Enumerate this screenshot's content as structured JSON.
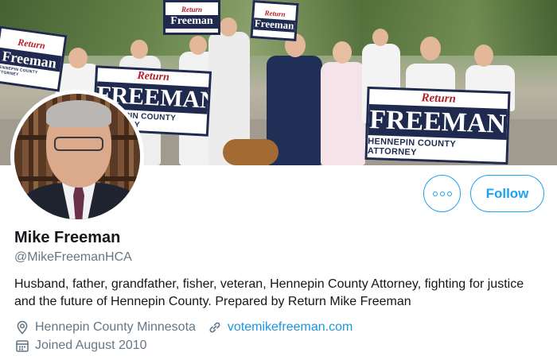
{
  "banner": {
    "signs": [
      {
        "return_text": "Return",
        "name_text": "Freeman",
        "sub_text": "HENNEPIN COUNTY ATTORNEY"
      },
      {
        "return_text": "Return",
        "name_text": "FREEMAN",
        "sub_text": "HENNEPIN COUNTY ATTORNEY"
      },
      {
        "return_text": "Return",
        "name_text": "FREEMAN",
        "sub_text": "HENNEPIN COUNTY ATTORNEY"
      },
      {
        "return_text": "Return",
        "name_text": "Freeman",
        "sub_text": ""
      },
      {
        "return_text": "Return",
        "name_text": "Freeman",
        "sub_text": ""
      }
    ]
  },
  "profile": {
    "display_name": "Mike Freeman",
    "handle": "@MikeFreemanHCA",
    "bio": "Husband, father, grandfather, fisher, veteran, Hennepin County Attorney, fighting for justice and the future of Hennepin County. Prepared by Return Mike Freeman",
    "location": "Hennepin County Minnesota",
    "website": "votemikefreeman.com",
    "joined": "Joined August 2010"
  },
  "actions": {
    "follow_label": "Follow",
    "more_icon": "more-options-icon"
  },
  "icons": {
    "location": "location-pin-icon",
    "link": "link-icon",
    "calendar": "calendar-icon"
  },
  "colors": {
    "accent": "#1da1f2",
    "link": "#1b95e0",
    "muted": "#657786",
    "text": "#14171a",
    "sign_navy": "#1f2a4e",
    "sign_red": "#b3202a"
  }
}
